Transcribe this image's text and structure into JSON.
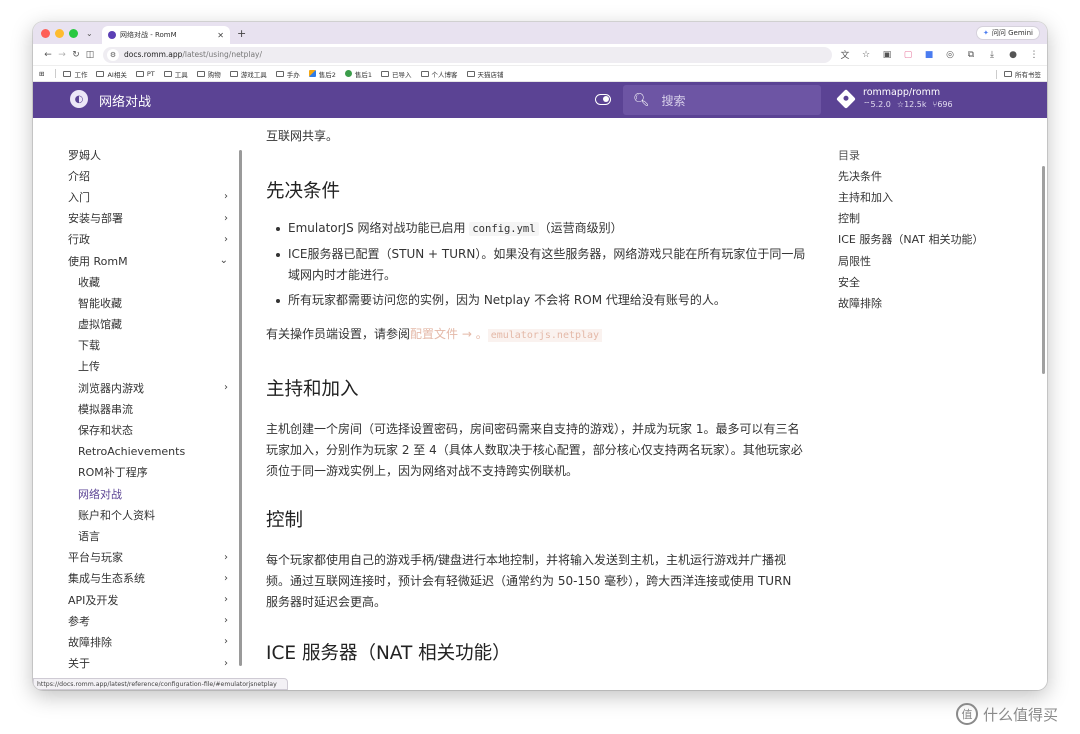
{
  "browser": {
    "tab_title": "网络对战 - RomM",
    "new_tab": "+",
    "gemini_label": "问问 Gemini",
    "url_host": "docs.romm.app",
    "url_path": "/latest/using/netplay/",
    "bookmarks": [
      "工作",
      "AI相关",
      "PT",
      "工具",
      "购物",
      "游戏工具",
      "手办",
      "售后2",
      "售后1",
      "已导入",
      "个人博客",
      "天猫店铺"
    ],
    "bookmarks_all": "所有书签",
    "status_url": "https://docs.romm.app/latest/reference/configuration-file/#emulatorjsnetplay"
  },
  "header": {
    "site_title": "网络对战",
    "search_placeholder": "搜索",
    "repo_name": "rommapp/romm",
    "repo_version": "5.2.0",
    "repo_stars": "12.5k",
    "repo_forks": "696"
  },
  "sidebar": {
    "items": [
      {
        "label": "罗姆人",
        "arrow": "",
        "sub": false,
        "active": false
      },
      {
        "label": "介绍",
        "arrow": "",
        "sub": false,
        "active": false
      },
      {
        "label": "入门",
        "arrow": ">",
        "sub": false,
        "active": false
      },
      {
        "label": "安装与部署",
        "arrow": ">",
        "sub": false,
        "active": false
      },
      {
        "label": "行政",
        "arrow": ">",
        "sub": false,
        "active": false
      },
      {
        "label": "使用 RomM",
        "arrow": "v",
        "sub": false,
        "active": false
      },
      {
        "label": "收藏",
        "arrow": "",
        "sub": true,
        "active": false
      },
      {
        "label": "智能收藏",
        "arrow": "",
        "sub": true,
        "active": false
      },
      {
        "label": "虚拟馆藏",
        "arrow": "",
        "sub": true,
        "active": false
      },
      {
        "label": "下载",
        "arrow": "",
        "sub": true,
        "active": false
      },
      {
        "label": "上传",
        "arrow": "",
        "sub": true,
        "active": false
      },
      {
        "label": "浏览器内游戏",
        "arrow": ">",
        "sub": true,
        "active": false
      },
      {
        "label": "模拟器串流",
        "arrow": "",
        "sub": true,
        "active": false
      },
      {
        "label": "保存和状态",
        "arrow": "",
        "sub": true,
        "active": false
      },
      {
        "label": "RetroAchievements",
        "arrow": "",
        "sub": true,
        "active": false
      },
      {
        "label": "ROM补丁程序",
        "arrow": "",
        "sub": true,
        "active": false
      },
      {
        "label": "网络对战",
        "arrow": "",
        "sub": true,
        "active": true
      },
      {
        "label": "账户和个人资料",
        "arrow": "",
        "sub": true,
        "active": false
      },
      {
        "label": "语言",
        "arrow": "",
        "sub": true,
        "active": false
      },
      {
        "label": "平台与玩家",
        "arrow": ">",
        "sub": false,
        "active": false
      },
      {
        "label": "集成与生态系统",
        "arrow": ">",
        "sub": false,
        "active": false
      },
      {
        "label": "API及开发",
        "arrow": ">",
        "sub": false,
        "active": false
      },
      {
        "label": "参考",
        "arrow": ">",
        "sub": false,
        "active": false
      },
      {
        "label": "故障排除",
        "arrow": ">",
        "sub": false,
        "active": false
      },
      {
        "label": "关于",
        "arrow": ">",
        "sub": false,
        "active": false
      }
    ]
  },
  "main": {
    "intro_tail": "互联网共享。",
    "prereq": {
      "heading": "先决条件",
      "b1_pre": "EmulatorJS 网络对战功能已启用",
      "b1_code": "config.yml",
      "b1_post": "（运营商级别）",
      "b2": "ICE服务器已配置（STUN + TURN）。如果没有这些服务器，网络游戏只能在所有玩家位于同一局域网内时才能进行。",
      "b3": "所有玩家都需要访问您的实例，因为 Netplay 不会将 ROM 代理给没有账号的人。",
      "ops_pre": "有关操作员端设置，请参阅",
      "ops_link": "配置文件 → 。",
      "ops_code": "emulatorjs.netplay"
    },
    "host": {
      "heading": "主持和加入",
      "text": "主机创建一个房间（可选择设置密码，房间密码需来自支持的游戏），并成为玩家 1。最多可以有三名玩家加入，分别作为玩家 2 至 4（具体人数取决于核心配置，部分核心仅支持两名玩家）。其他玩家必须位于同一游戏实例上，因为网络对战不支持跨实例联机。"
    },
    "control": {
      "heading": "控制",
      "text": "每个玩家都使用自己的游戏手柄/键盘进行本地控制，并将输入发送到主机，主机运行游戏并广播视频。通过互联网连接时，预计会有轻微延迟（通常约为 50-150 毫秒），跨大西洋连接或使用 TURN 服务器时延迟会更高。"
    },
    "ice": {
      "heading": "ICE 服务器（NAT 相关功能）"
    }
  },
  "toc": {
    "title": "目录",
    "items": [
      "先决条件",
      "主持和加入",
      "控制",
      "ICE 服务器（NAT 相关功能）",
      "局限性",
      "安全",
      "故障排除"
    ]
  },
  "watermark": "什么值得买",
  "colors": {
    "header": "#5b4394",
    "active": "#5b4394",
    "link": "#e4b9a8"
  }
}
